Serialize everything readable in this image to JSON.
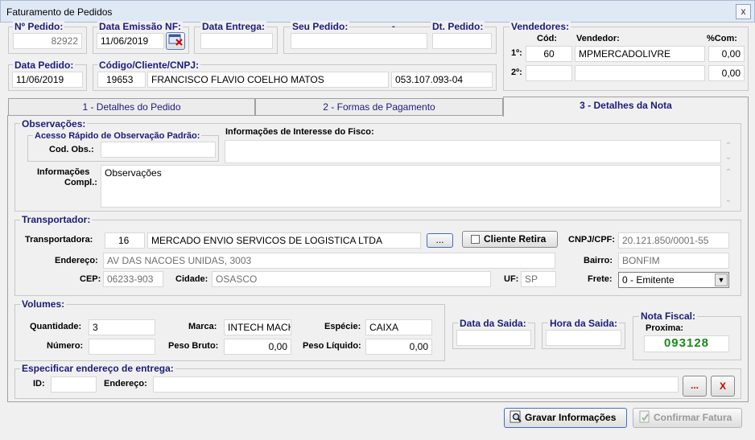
{
  "window": {
    "title": "Faturamento de Pedidos",
    "close": "x"
  },
  "header": {
    "num_pedido": {
      "label": "Nº Pedido:",
      "value": "82922"
    },
    "data_emissao": {
      "label": "Data Emissão NF:",
      "value": "11/06/2019"
    },
    "data_entrega": {
      "label": "Data Entrega:",
      "value": ""
    },
    "seu_pedido": {
      "label": "Seu Pedido:",
      "dash": "-",
      "value": ""
    },
    "dt_pedido": {
      "label": "Dt. Pedido:",
      "value": ""
    },
    "data_pedido": {
      "label": "Data Pedido:",
      "value": "11/06/2019"
    },
    "cliente": {
      "label": "Código/Cliente/CNPJ:",
      "code": "19653",
      "name": "FRANCISCO FLAVIO COELHO MATOS",
      "cnpj": "053.107.093-04"
    }
  },
  "vendedores": {
    "title": "Vendedores:",
    "col_cod": "Cód:",
    "col_vendedor": "Vendedor:",
    "col_com": "%Com:",
    "rows": [
      {
        "label": "1º:",
        "cod": "60",
        "name": "MPMERCADOLIVRE",
        "com": "0,00"
      },
      {
        "label": "2º:",
        "cod": "",
        "name": "",
        "com": "0,00"
      }
    ]
  },
  "tabs": [
    "1 - Detalhes do Pedido",
    "2 - Formas de Pagamento",
    "3 - Detalhes da Nota"
  ],
  "observacoes": {
    "title": "Observações:",
    "quick_title": "Acesso Rápido de Observação Padrão:",
    "cod_obs": "Cod.  Obs.:",
    "fisco_label": "Informações de Interesse do Fisco:",
    "fisco_value": "",
    "compl_label1": "Informações",
    "compl_label2": "Compl.:",
    "compl_value": "Observações"
  },
  "transportador": {
    "title": "Transportador:",
    "label": "Transportadora:",
    "code": "16",
    "name": "MERCADO ENVIO SERVICOS DE LOGISTICA LTDA",
    "browse": "...",
    "cliente_retira": "Cliente Retira",
    "cnpj_label": "CNPJ/CPF:",
    "cnpj": "20.121.850/0001-55",
    "endereco_label": "Endereço:",
    "endereco": "AV DAS NACOES UNIDAS, 3003",
    "bairro_label": "Bairro:",
    "bairro": "BONFIM",
    "cep_label": "CEP:",
    "cep": "06233-903",
    "cidade_label": "Cidade:",
    "cidade": "OSASCO",
    "uf_label": "UF:",
    "uf": "SP",
    "frete_label": "Frete:",
    "frete": "0 - Emitente"
  },
  "volumes": {
    "title": "Volumes:",
    "quantidade_label": "Quantidade:",
    "quantidade": "3",
    "marca_label": "Marca:",
    "marca": "INTECH MACH",
    "especie_label": "Espécie:",
    "especie": "CAIXA",
    "numero_label": "Número:",
    "numero": "",
    "peso_bruto_label": "Peso Bruto:",
    "peso_bruto": "0,00",
    "peso_liquido_label": "Peso Líquido:",
    "peso_liquido": "0,00"
  },
  "saida": {
    "data_label": "Data da Saida:",
    "data": "",
    "hora_label": "Hora da Saida:",
    "hora": ""
  },
  "nota_fiscal": {
    "title": "Nota Fiscal:",
    "proxima_label": "Proxima:",
    "proxima": "093128"
  },
  "entrega": {
    "title": "Especificar endereço de entrega:",
    "id_label": "ID:",
    "id": "",
    "endereco_label": "Endereço:",
    "endereco": "",
    "browse": "...",
    "clear": "X"
  },
  "actions": {
    "gravar": "Gravar Informações",
    "confirmar": "Confirmar Fatura"
  },
  "colors": {
    "title_blue": "#1c1c7a",
    "nf_green": "#1a8a1a",
    "clear_red": "#cc0000"
  }
}
